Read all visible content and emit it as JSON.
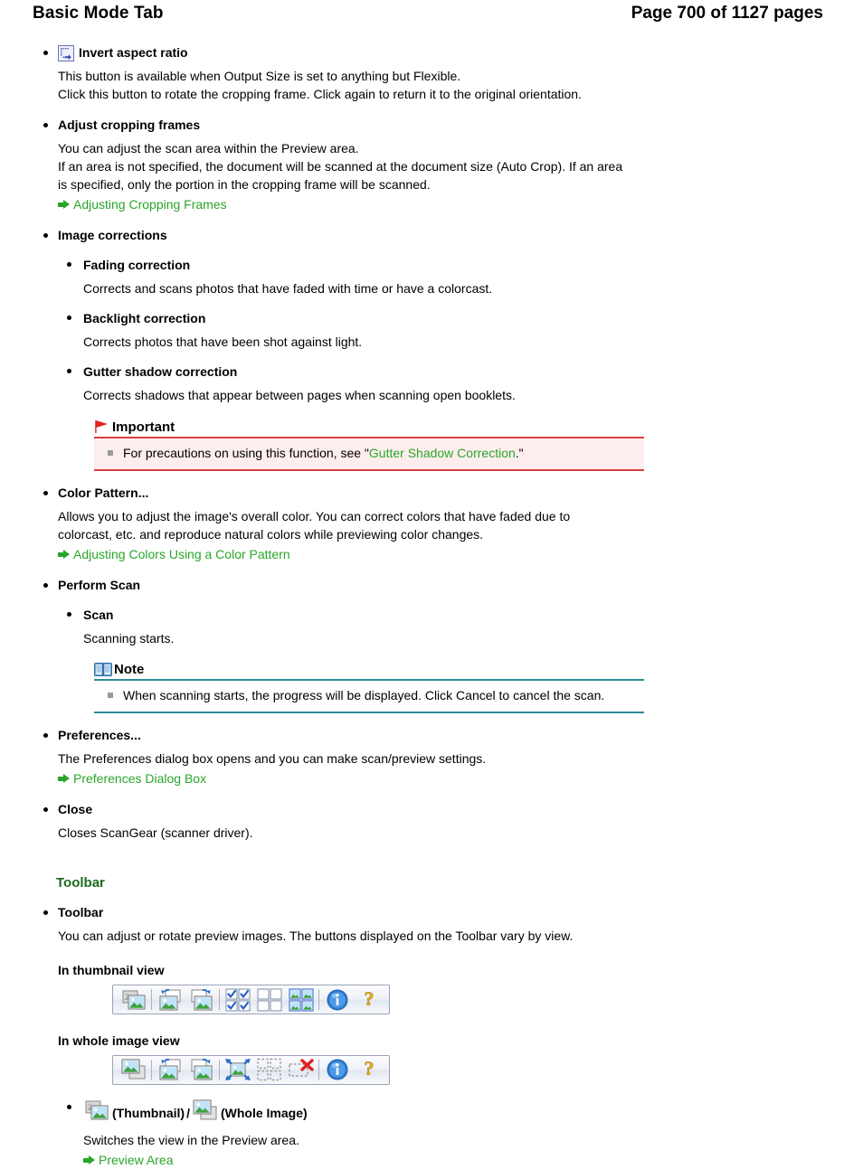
{
  "header": {
    "title": "Basic Mode Tab",
    "page_label": "Page 700 of 1127 pages"
  },
  "colors": {
    "green_link": "#2aa52a",
    "section_heading": "#1d6b1d",
    "important_border": "#d94040",
    "important_bg": "#fdeeee",
    "note_border": "#2e8a96",
    "text": "#000000"
  },
  "items": {
    "invert_aspect_ratio": {
      "icon": "invert-aspect-ratio-icon",
      "term": "Invert aspect ratio",
      "lines": [
        "This button is available when Output Size is set to anything but Flexible.",
        "Click this button to rotate the cropping frame. Click again to return it to the original orientation."
      ]
    },
    "adjust_cropping_frames": {
      "term": "Adjust cropping frames",
      "lines": [
        "You can adjust the scan area within the Preview area.",
        "If an area is not specified, the document will be scanned at the document size (Auto Crop). If an area",
        "is specified, only the portion in the cropping frame will be scanned."
      ],
      "link": "Adjusting Cropping Frames"
    },
    "image_corrections": {
      "term": "Image corrections",
      "sub": [
        {
          "term": "Fading correction",
          "desc": "Corrects and scans photos that have faded with time or have a colorcast."
        },
        {
          "term": "Backlight correction",
          "desc": "Corrects photos that have been shot against light."
        },
        {
          "term": "Gutter shadow correction",
          "desc": "Corrects shadows that appear between pages when scanning open booklets."
        }
      ]
    },
    "important_callout": {
      "icon": "red-flag-icon",
      "heading": "Important",
      "text_before": "For precautions on using this function, see \"",
      "link": "Gutter Shadow Correction",
      "text_after": ".\""
    },
    "color_pattern": {
      "term": "Color Pattern...",
      "lines": [
        "Allows you to adjust the image's overall color. You can correct colors that have faded due to",
        "colorcast, etc. and reproduce natural colors while previewing color changes."
      ],
      "link": "Adjusting Colors Using a Color Pattern"
    },
    "perform_scan": {
      "term": "Perform Scan",
      "sub": [
        {
          "term": "Scan",
          "desc": "Scanning starts."
        }
      ]
    },
    "note_callout": {
      "icon": "book-note-icon",
      "heading": "Note",
      "text": "When scanning starts, the progress will be displayed. Click Cancel to cancel the scan."
    },
    "preferences": {
      "term": "Preferences...",
      "lines": [
        "The Preferences dialog box opens and you can make scan/preview settings."
      ],
      "link": "Preferences Dialog Box"
    },
    "close": {
      "term": "Close",
      "lines": [
        "Closes ScanGear (scanner driver)."
      ]
    }
  },
  "toolbar_section": {
    "heading": "Toolbar",
    "term": "Toolbar",
    "desc": "You can adjust or rotate preview images. The buttons displayed on the Toolbar vary by view.",
    "thumbnail_view_label": "In thumbnail view",
    "whole_image_view_label": "In whole image view",
    "thumbnail_view_buttons": [
      "thumbnail-view-icon",
      "separator",
      "rotate-left-icon",
      "rotate-right-icon",
      "separator",
      "select-all-frames-icon",
      "deselect-all-frames-icon",
      "select-all-images-icon",
      "separator",
      "info-icon",
      "help-icon"
    ],
    "whole_image_view_buttons": [
      "whole-image-view-icon",
      "separator",
      "rotate-left-icon",
      "rotate-right-icon",
      "separator",
      "auto-crop-icon",
      "multi-crop-icon",
      "remove-crop-icon",
      "separator",
      "info-icon",
      "help-icon"
    ],
    "view_switch": {
      "thumbnail_icon": "thumbnail-view-icon",
      "thumbnail_label": "(Thumbnail)",
      "divider": "/",
      "whole_image_icon": "whole-image-view-icon",
      "whole_image_label": "(Whole Image)",
      "desc": "Switches the view in the Preview area.",
      "link": "Preview Area"
    }
  }
}
